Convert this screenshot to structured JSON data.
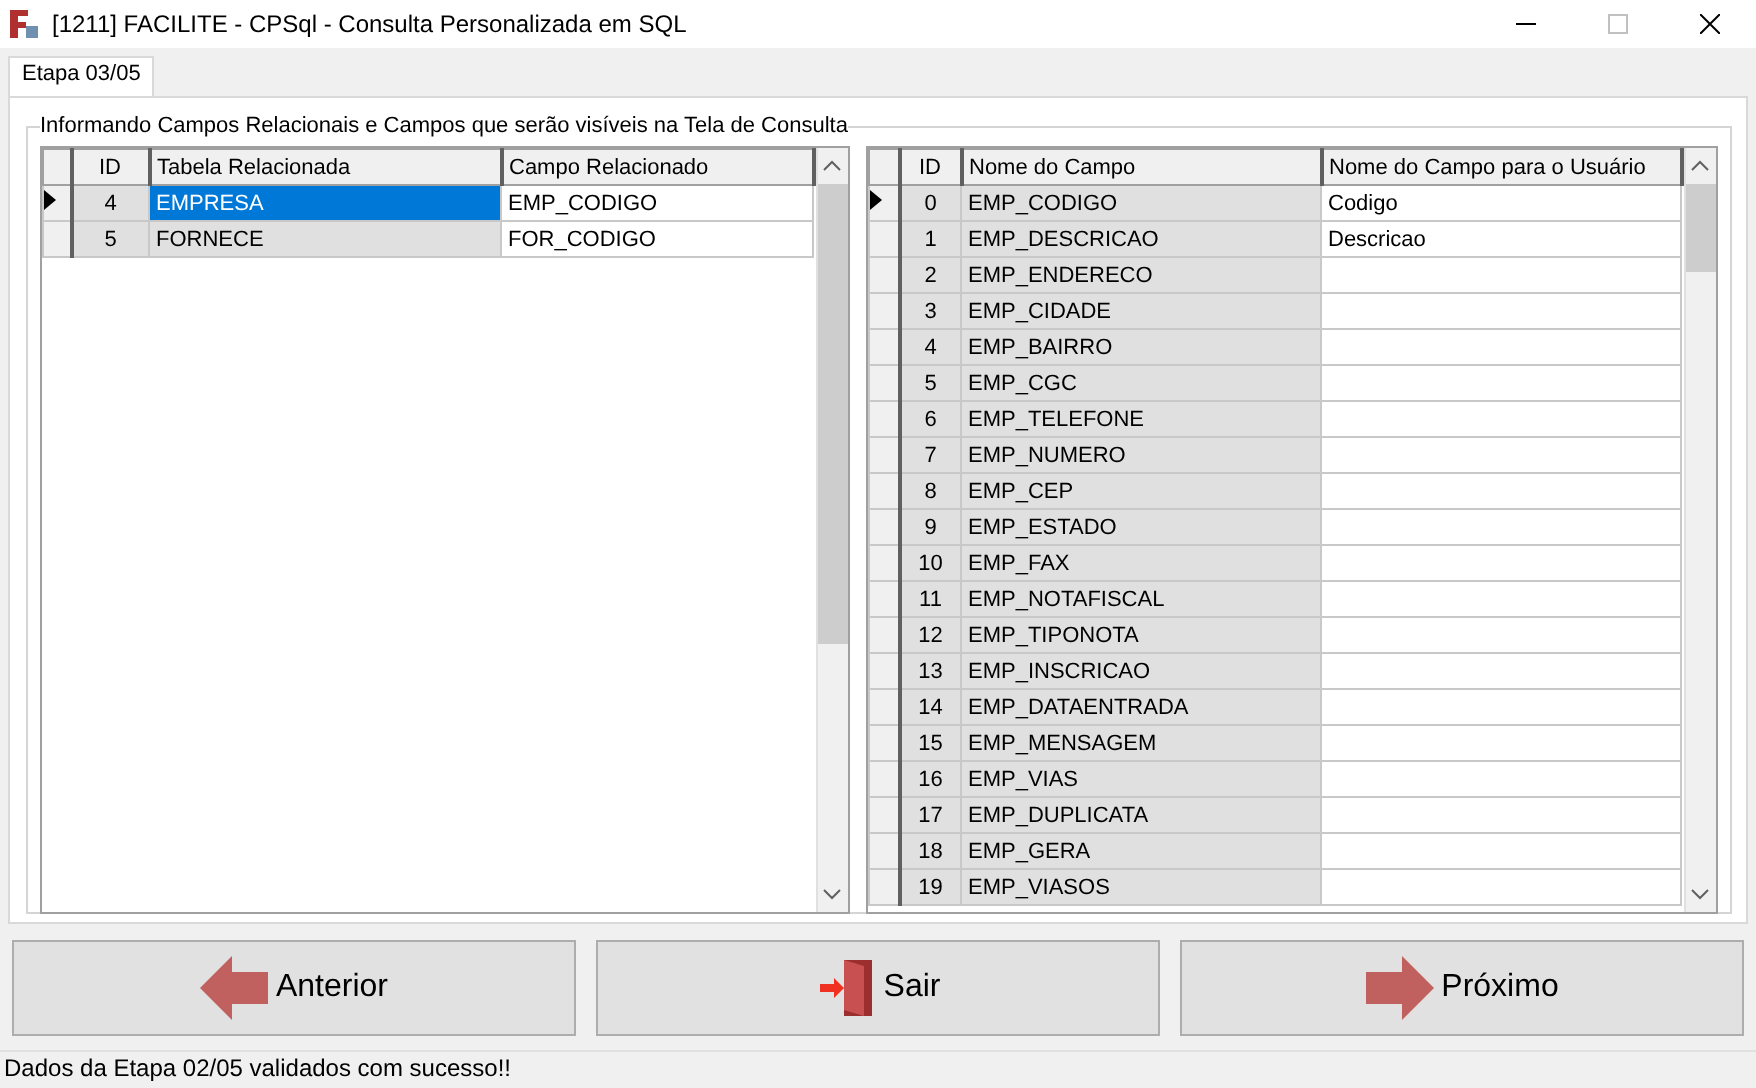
{
  "window": {
    "title": "[1211] FACILITE - CPSql - Consulta Personalizada em SQL",
    "maximize_disabled": true
  },
  "tabs": [
    {
      "label": "Etapa 03/05",
      "selected": true
    }
  ],
  "group": {
    "title": "Informando Campos Relacionais e Campos que serão visíveis na Tela de Consulta"
  },
  "left_grid": {
    "columns": [
      "ID",
      "Tabela Relacionada",
      "Campo Relacionado"
    ],
    "rows": [
      {
        "id": "4",
        "tabela": "EMPRESA",
        "campo": "EMP_CODIGO",
        "selected": true
      },
      {
        "id": "5",
        "tabela": "FORNECE",
        "campo": "FOR_CODIGO",
        "selected": false
      }
    ]
  },
  "right_grid": {
    "columns": [
      "ID",
      "Nome do Campo",
      "Nome do Campo para o Usuário"
    ],
    "rows": [
      {
        "id": "0",
        "campo": "EMP_CODIGO",
        "usuario": "Codigo",
        "selected": true
      },
      {
        "id": "1",
        "campo": "EMP_DESCRICAO",
        "usuario": "Descricao",
        "selected": false
      },
      {
        "id": "2",
        "campo": "EMP_ENDERECO",
        "selected": false
      },
      {
        "id": "3",
        "campo": "EMP_CIDADE",
        "selected": false
      },
      {
        "id": "4",
        "campo": "EMP_BAIRRO",
        "selected": false
      },
      {
        "id": "5",
        "campo": "EMP_CGC",
        "selected": false
      },
      {
        "id": "6",
        "campo": "EMP_TELEFONE",
        "selected": false
      },
      {
        "id": "7",
        "campo": "EMP_NUMERO",
        "selected": false
      },
      {
        "id": "8",
        "campo": "EMP_CEP",
        "selected": false
      },
      {
        "id": "9",
        "campo": "EMP_ESTADO",
        "selected": false
      },
      {
        "id": "10",
        "campo": "EMP_FAX",
        "selected": false
      },
      {
        "id": "11",
        "campo": "EMP_NOTAFISCAL",
        "selected": false
      },
      {
        "id": "12",
        "campo": "EMP_TIPONOTA",
        "selected": false
      },
      {
        "id": "13",
        "campo": "EMP_INSCRICAO",
        "selected": false
      },
      {
        "id": "14",
        "campo": "EMP_DATAENTRADA",
        "selected": false
      },
      {
        "id": "15",
        "campo": "EMP_MENSAGEM",
        "selected": false
      },
      {
        "id": "16",
        "campo": "EMP_VIAS",
        "selected": false
      },
      {
        "id": "17",
        "campo": "EMP_DUPLICATA",
        "selected": false
      },
      {
        "id": "18",
        "campo": "EMP_GERA",
        "selected": false
      },
      {
        "id": "19",
        "campo": "EMP_VIASOS",
        "selected": false
      }
    ]
  },
  "buttons": [
    {
      "label": "Anterior",
      "kind": "back"
    },
    {
      "label": "Sair",
      "kind": "exit"
    },
    {
      "label": "Próximo",
      "kind": "next"
    }
  ],
  "status_bar": "Dados da Etapa 02/05 validados com sucesso!!"
}
